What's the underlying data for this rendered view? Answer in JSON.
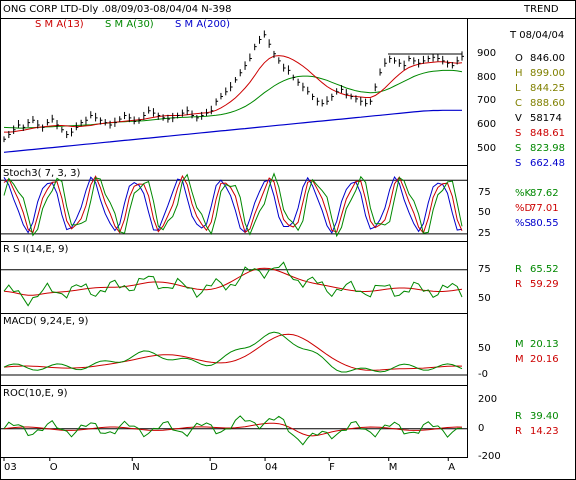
{
  "header": {
    "title": "ONG CORP LTD-Dly .08/09/03-08/04/04  N-398",
    "label": "TREND"
  },
  "chart_data": [
    {
      "type": "line",
      "panel": "price",
      "legend": [
        "S M A(13)",
        "S M A(30)",
        "S M A(200)"
      ],
      "legend_colors": [
        "#cc0000",
        "#008800",
        "#0000cc"
      ],
      "date_label": "T 08/04/04",
      "ohlc": [
        {
          "key": "O",
          "value": "846.00",
          "color": "#000000"
        },
        {
          "key": "H",
          "value": "899.00",
          "color": "#808000"
        },
        {
          "key": "L",
          "value": "844.25",
          "color": "#808000"
        },
        {
          "key": "C",
          "value": "888.60",
          "color": "#808000"
        },
        {
          "key": "V",
          "value": "58174",
          "color": "#000000"
        },
        {
          "key": "S",
          "value": "848.61",
          "color": "#cc0000"
        },
        {
          "key": "S",
          "value": "823.98",
          "color": "#008800"
        },
        {
          "key": "S",
          "value": "662.48",
          "color": "#0000cc"
        }
      ],
      "yticks": [
        "900",
        "800",
        "700",
        "600",
        "500"
      ],
      "ytick_values": [
        900,
        800,
        700,
        600,
        500
      ],
      "ylim": [
        440,
        1000
      ],
      "price_close": [
        540,
        560,
        580,
        600,
        590,
        610,
        620,
        600,
        590,
        610,
        625,
        600,
        580,
        560,
        570,
        590,
        610,
        620,
        640,
        630,
        620,
        610,
        600,
        610,
        625,
        640,
        630,
        615,
        620,
        640,
        660,
        650,
        640,
        630,
        625,
        630,
        640,
        650,
        660,
        640,
        630,
        640,
        650,
        660,
        700,
        720,
        740,
        760,
        790,
        820,
        850,
        880,
        930,
        960,
        980,
        940,
        900,
        870,
        840,
        830,
        800,
        780,
        760,
        740,
        720,
        700,
        690,
        700,
        720,
        740,
        750,
        730,
        720,
        710,
        700,
        690,
        700,
        760,
        820,
        860,
        880,
        870,
        860,
        850,
        880,
        870,
        860,
        870,
        880,
        885,
        880,
        870,
        860,
        850,
        870,
        889
      ],
      "sma13": [
        570,
        570,
        572,
        575,
        578,
        582,
        586,
        590,
        592,
        594,
        596,
        598,
        598,
        596,
        594,
        593,
        594,
        596,
        598,
        602,
        605,
        608,
        610,
        612,
        614,
        616,
        618,
        620,
        622,
        624,
        628,
        632,
        636,
        638,
        640,
        640,
        640,
        641,
        643,
        646,
        648,
        650,
        652,
        655,
        662,
        672,
        684,
        698,
        714,
        734,
        756,
        780,
        808,
        838,
        862,
        880,
        890,
        892,
        890,
        884,
        874,
        862,
        848,
        832,
        814,
        796,
        778,
        762,
        750,
        740,
        732,
        726,
        722,
        720,
        718,
        716,
        716,
        724,
        738,
        756,
        776,
        796,
        814,
        830,
        842,
        850,
        856,
        860,
        862,
        864,
        866,
        866,
        864,
        862,
        860,
        862
      ],
      "sma30": [
        590,
        589,
        588,
        587,
        587,
        588,
        589,
        590,
        591,
        592,
        593,
        594,
        595,
        596,
        597,
        598,
        599,
        600,
        601,
        603,
        605,
        607,
        609,
        611,
        613,
        614,
        615,
        616,
        617,
        618,
        620,
        622,
        624,
        626,
        628,
        630,
        631,
        632,
        633,
        634,
        635,
        636,
        637,
        639,
        641,
        644,
        648,
        653,
        660,
        668,
        678,
        690,
        704,
        720,
        736,
        750,
        764,
        776,
        786,
        794,
        800,
        804,
        806,
        806,
        804,
        800,
        794,
        788,
        780,
        772,
        764,
        756,
        750,
        744,
        740,
        738,
        736,
        737,
        740,
        746,
        754,
        764,
        774,
        784,
        794,
        804,
        812,
        818,
        823,
        826,
        828,
        830,
        830,
        830,
        828,
        824
      ],
      "sma200": [
        485,
        487,
        489,
        491,
        493,
        495,
        497,
        499,
        501,
        503,
        505,
        507,
        509,
        511,
        513,
        515,
        517,
        519,
        521,
        523,
        525,
        527,
        529,
        531,
        533,
        535,
        537,
        539,
        541,
        543,
        545,
        547,
        549,
        551,
        553,
        555,
        557,
        559,
        561,
        563,
        565,
        567,
        569,
        571,
        573,
        575,
        577,
        579,
        581,
        583,
        585,
        587,
        589,
        591,
        593,
        595,
        597,
        599,
        601,
        603,
        605,
        607,
        609,
        611,
        613,
        615,
        617,
        619,
        621,
        623,
        625,
        627,
        629,
        631,
        633,
        635,
        637,
        639,
        641,
        643,
        645,
        647,
        649,
        651,
        653,
        655,
        657,
        659,
        660,
        661,
        661,
        662,
        662,
        662,
        662,
        662
      ]
    },
    {
      "type": "line",
      "panel": "stochastic",
      "title": "Stoch3( 7, 3, 3)",
      "yticks": [
        "75",
        "50",
        "25"
      ],
      "ytick_values": [
        75,
        50,
        25
      ],
      "ylim": [
        20,
        100
      ],
      "hlines": [
        90,
        25
      ],
      "series": [
        {
          "name": "%K",
          "value": "87.62",
          "color": "#008800"
        },
        {
          "name": "%D",
          "value": "77.01",
          "color": "#cc0000"
        },
        {
          "name": "%S",
          "value": "80.55",
          "color": "#0000cc"
        }
      ]
    },
    {
      "type": "line",
      "panel": "rsi",
      "title": "R S I(14,E, 9)",
      "yticks": [
        "75",
        "50"
      ],
      "ytick_values": [
        75,
        50
      ],
      "ylim": [
        40,
        90
      ],
      "hlines": [
        75
      ],
      "series": [
        {
          "name": "R",
          "value": "65.52",
          "color": "#008800"
        },
        {
          "name": "R",
          "value": "59.29",
          "color": "#cc0000"
        }
      ]
    },
    {
      "type": "line",
      "panel": "macd",
      "title": "MACD( 9,24,E, 9)",
      "yticks": [
        "50",
        "-0"
      ],
      "ytick_values": [
        50,
        0
      ],
      "ylim": [
        -15,
        100
      ],
      "hlines": [
        0
      ],
      "series": [
        {
          "name": "M",
          "value": "20.13",
          "color": "#008800"
        },
        {
          "name": "M",
          "value": "20.16",
          "color": "#cc0000"
        }
      ]
    },
    {
      "type": "line",
      "panel": "roc",
      "title": "ROC(10,E, 9)",
      "yticks": [
        "200",
        "0",
        "-200"
      ],
      "ytick_values": [
        200,
        0,
        -200
      ],
      "ylim": [
        -220,
        230
      ],
      "hlines": [
        0
      ],
      "series": [
        {
          "name": "R",
          "value": "39.40",
          "color": "#008800"
        },
        {
          "name": "R",
          "value": "14.23",
          "color": "#cc0000"
        }
      ]
    }
  ],
  "xaxis": {
    "labels": [
      "03",
      "O",
      "N",
      "D",
      "04",
      "F",
      "M",
      "A"
    ],
    "positions": [
      0,
      0.1,
      0.28,
      0.45,
      0.57,
      0.71,
      0.84,
      0.97
    ]
  }
}
